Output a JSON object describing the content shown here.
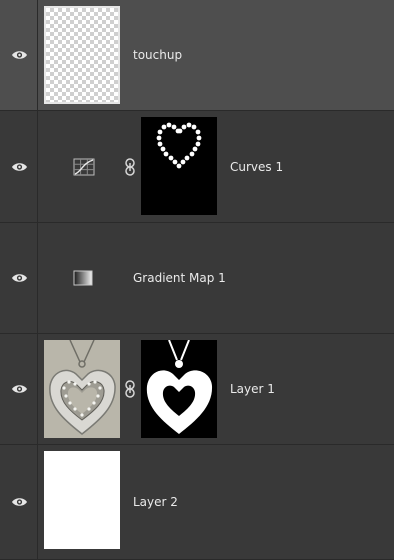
{
  "layers_panel": {
    "layers": [
      {
        "name": "touchup",
        "type": "pixel",
        "thumbnail": "transparent-checker",
        "visible": true,
        "selected": true
      },
      {
        "name": "Curves 1",
        "type": "adjustment",
        "adjustment_icon": "curves-icon",
        "mask": "heart-beads-mask",
        "linked": true,
        "visible": true,
        "selected": false
      },
      {
        "name": "Gradient Map 1",
        "type": "adjustment",
        "adjustment_icon": "gradient-map-icon",
        "visible": true,
        "selected": false
      },
      {
        "name": "Layer 1",
        "type": "pixel",
        "thumbnail": "heart-pendant-photo",
        "mask": "heart-pendant-mask",
        "linked": true,
        "visible": true,
        "selected": false
      },
      {
        "name": "Layer 2",
        "type": "pixel",
        "thumbnail": "white-fill",
        "visible": true,
        "selected": false
      }
    ]
  },
  "colors": {
    "panel_bg": "#393939",
    "selected_row_bg": "#4e4e4e",
    "divider": "#2a2a2a",
    "text": "#eaeaea"
  }
}
